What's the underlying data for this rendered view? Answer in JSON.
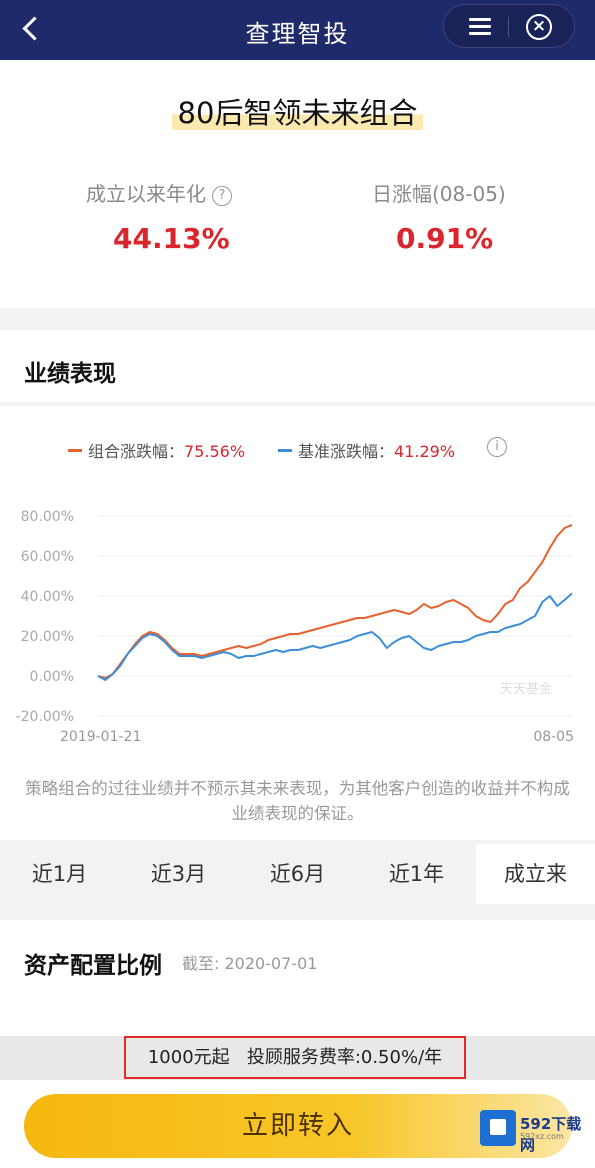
{
  "nav": {
    "title": "查理智投"
  },
  "header": {
    "fund_name": "80后智领未来组合",
    "annualized_label": "成立以来年化",
    "annualized_value": "44.13%",
    "daily_label": "日涨幅(08-05)",
    "daily_value": "0.91%"
  },
  "performance": {
    "title": "业绩表现",
    "legend": [
      {
        "label": "组合涨跌幅：",
        "value": "75.56%",
        "color": "#e8612c"
      },
      {
        "label": "基准涨跌幅：",
        "value": "41.29%",
        "color": "#3b8fd8"
      }
    ],
    "disclaimer": "策略组合的过往业绩并不预示其未来表现，为其他客户创造的收益并不构成业绩表现的保证。",
    "ranges": [
      "近1月",
      "近3月",
      "近6月",
      "近1年",
      "成立来"
    ],
    "active_range": "成立来"
  },
  "chart_data": {
    "type": "line",
    "y_ticks": [
      "80.00%",
      "60.00%",
      "40.00%",
      "20.00%",
      "0.00%",
      "-20.00%"
    ],
    "ylim": [
      -20,
      80
    ],
    "x_start_label": "2019-01-21",
    "x_end_label": "08-05",
    "chart_watermark": "天天基金",
    "series": [
      {
        "name": "组合涨跌幅",
        "color": "#e8612c",
        "values": [
          0,
          -1,
          1,
          6,
          11,
          16,
          20,
          22,
          21,
          18,
          14,
          11,
          11,
          11,
          10,
          11,
          12,
          13,
          14,
          15,
          14,
          15,
          16,
          18,
          19,
          20,
          21,
          21,
          22,
          23,
          24,
          25,
          26,
          27,
          28,
          29,
          29,
          30,
          31,
          32,
          33,
          32,
          31,
          33,
          36,
          34,
          35,
          37,
          38,
          36,
          34,
          30,
          28,
          27,
          31,
          36,
          38,
          44,
          47,
          52,
          57,
          64,
          70,
          74,
          75.56
        ]
      },
      {
        "name": "基准涨跌幅",
        "color": "#3b8fd8",
        "values": [
          0,
          -2,
          1,
          5,
          11,
          15,
          19,
          21,
          20,
          17,
          13,
          10,
          10,
          10,
          9,
          10,
          11,
          12,
          11,
          9,
          10,
          10,
          11,
          12,
          13,
          12,
          13,
          13,
          14,
          15,
          14,
          15,
          16,
          17,
          18,
          20,
          21,
          22,
          19,
          14,
          17,
          19,
          20,
          17,
          14,
          13,
          15,
          16,
          17,
          17,
          18,
          20,
          21,
          22,
          22,
          24,
          25,
          26,
          28,
          30,
          37,
          40,
          35,
          38,
          41.29
        ]
      }
    ]
  },
  "allocation": {
    "title": "资产配置比例",
    "as_of": "截至: 2020-07-01"
  },
  "fee": {
    "text": "1000元起   投顾服务费率:0.50%/年"
  },
  "cta": {
    "label": "立即转入"
  },
  "site_watermark": {
    "name": "592下载网",
    "url": "592xz.com"
  }
}
